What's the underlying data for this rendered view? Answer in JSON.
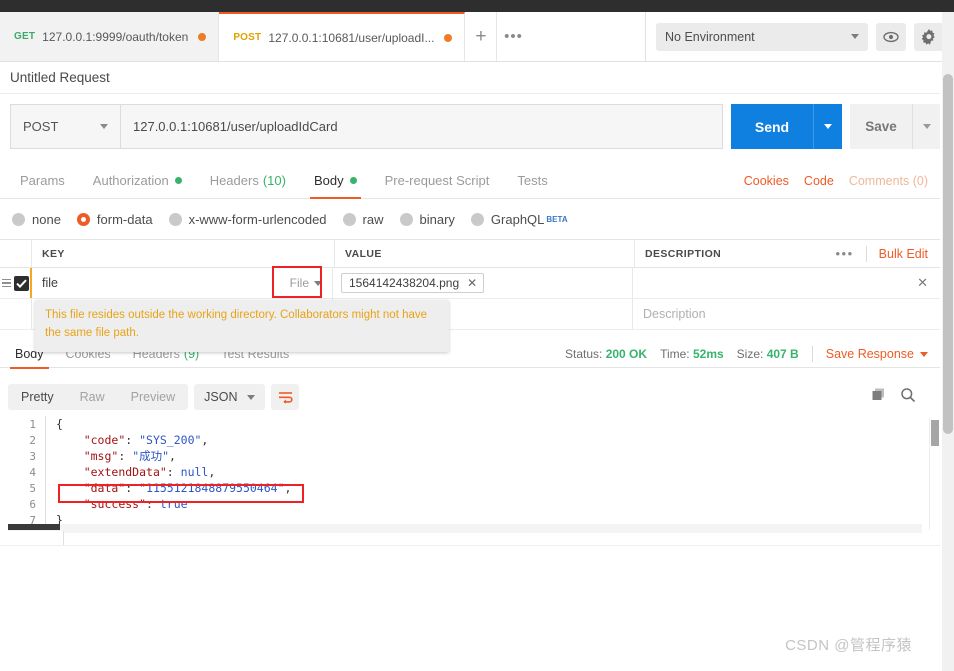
{
  "window": {
    "env_label": "No Environment",
    "eye_icon": "eye-icon",
    "gear_icon": "gear-icon"
  },
  "tabs": [
    {
      "method": "GET",
      "url": "127.0.0.1:9999/oauth/token",
      "active": false,
      "unsaved": true
    },
    {
      "method": "POST",
      "url": "127.0.0.1:10681/user/uploadI...",
      "active": true,
      "unsaved": true
    }
  ],
  "tabstrip": {
    "new_tab": "+",
    "more": "•••"
  },
  "request": {
    "title": "Untitled Request",
    "method": "POST",
    "url": "127.0.0.1:10681/user/uploadIdCard",
    "send_label": "Send",
    "save_label": "Save"
  },
  "request_tabs": [
    {
      "label": "Params",
      "active": false,
      "dot": false,
      "count": ""
    },
    {
      "label": "Authorization",
      "active": false,
      "dot": true,
      "count": ""
    },
    {
      "label": "Headers",
      "active": false,
      "dot": false,
      "count": "(10)"
    },
    {
      "label": "Body",
      "active": true,
      "dot": true,
      "count": ""
    },
    {
      "label": "Pre-request Script",
      "active": false,
      "dot": false,
      "count": ""
    },
    {
      "label": "Tests",
      "active": false,
      "dot": false,
      "count": ""
    }
  ],
  "request_tabs_right": {
    "cookies": "Cookies",
    "code": "Code",
    "comments": "Comments (0)"
  },
  "body_types": [
    {
      "label": "none",
      "checked": false
    },
    {
      "label": "form-data",
      "checked": true
    },
    {
      "label": "x-www-form-urlencoded",
      "checked": false
    },
    {
      "label": "raw",
      "checked": false
    },
    {
      "label": "binary",
      "checked": false
    },
    {
      "label": "GraphQL",
      "checked": false,
      "badge": "BETA"
    }
  ],
  "kv_table": {
    "headers": {
      "key": "KEY",
      "value": "VALUE",
      "description": "DESCRIPTION"
    },
    "bulk_edit": "Bulk Edit",
    "more_dots": "•••",
    "rows": [
      {
        "checked": true,
        "key": "file",
        "key_type": "File",
        "file_name": "1564142438204.png",
        "description": "",
        "remove": "✕"
      },
      {
        "checked": false,
        "key": "",
        "key_type": "",
        "file_name": "",
        "description": "Description",
        "remove": ""
      }
    ]
  },
  "tooltip": {
    "text": "This file resides outside the working directory. Collaborators might not have the same file path."
  },
  "response_tabs": [
    {
      "label": "Body",
      "active": true,
      "count": ""
    },
    {
      "label": "Cookies",
      "active": false,
      "count": ""
    },
    {
      "label": "Headers",
      "active": false,
      "count": "(9)"
    },
    {
      "label": "Test Results",
      "active": false,
      "count": ""
    }
  ],
  "response_meta": {
    "status_label": "Status:",
    "status_value": "200 OK",
    "time_label": "Time:",
    "time_value": "52ms",
    "size_label": "Size:",
    "size_value": "407 B",
    "save_response": "Save Response"
  },
  "viewer": {
    "modes": [
      {
        "label": "Pretty",
        "active": true
      },
      {
        "label": "Raw",
        "active": false
      },
      {
        "label": "Preview",
        "active": false
      }
    ],
    "format": "JSON",
    "wrap_icon": "word-wrap-icon",
    "copy_icon": "copy-icon",
    "search_icon": "search-icon"
  },
  "response_body": {
    "lines": [
      {
        "n": "1",
        "segments": [
          {
            "t": "{",
            "c": "k-punc"
          }
        ]
      },
      {
        "n": "2",
        "segments": [
          {
            "t": "    ",
            "c": "k-punc"
          },
          {
            "t": "\"code\"",
            "c": "k-key"
          },
          {
            "t": ": ",
            "c": "k-punc"
          },
          {
            "t": "\"SYS_200\"",
            "c": "k-str"
          },
          {
            "t": ",",
            "c": "k-punc"
          }
        ]
      },
      {
        "n": "3",
        "segments": [
          {
            "t": "    ",
            "c": "k-punc"
          },
          {
            "t": "\"msg\"",
            "c": "k-key"
          },
          {
            "t": ": ",
            "c": "k-punc"
          },
          {
            "t": "\"成功\"",
            "c": "k-str"
          },
          {
            "t": ",",
            "c": "k-punc"
          }
        ]
      },
      {
        "n": "4",
        "segments": [
          {
            "t": "    ",
            "c": "k-punc"
          },
          {
            "t": "\"extendData\"",
            "c": "k-key"
          },
          {
            "t": ": ",
            "c": "k-punc"
          },
          {
            "t": "null",
            "c": "k-null"
          },
          {
            "t": ",",
            "c": "k-punc"
          }
        ]
      },
      {
        "n": "5",
        "segments": [
          {
            "t": "    ",
            "c": "k-punc"
          },
          {
            "t": "\"data\"",
            "c": "k-key"
          },
          {
            "t": ": ",
            "c": "k-punc"
          },
          {
            "t": "\"1155121848879550464\"",
            "c": "k-str"
          },
          {
            "t": ",",
            "c": "k-punc"
          }
        ]
      },
      {
        "n": "6",
        "segments": [
          {
            "t": "    ",
            "c": "k-punc"
          },
          {
            "t": "\"success\"",
            "c": "k-key"
          },
          {
            "t": ": ",
            "c": "k-punc"
          },
          {
            "t": "true",
            "c": "k-bool"
          }
        ]
      },
      {
        "n": "7",
        "segments": [
          {
            "t": "}",
            "c": "k-punc"
          }
        ]
      }
    ]
  },
  "watermark": "CSDN @管程序猿"
}
